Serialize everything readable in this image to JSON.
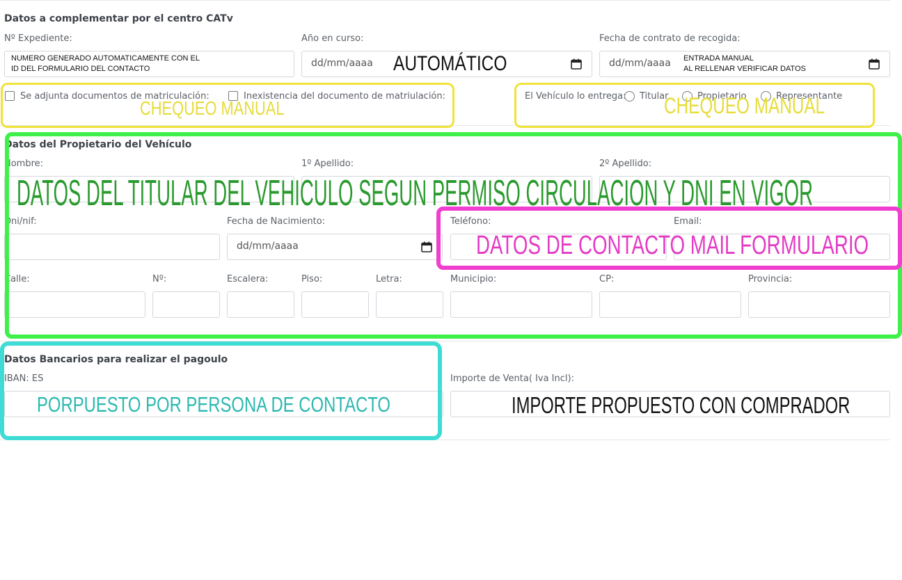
{
  "sections": {
    "centro": "Datos a complementar por el centro CATv",
    "propietario": "Datos del Propietario del Vehículo",
    "bancarios": "Datos Bancarios para realizar el pagoulo"
  },
  "labels": {
    "expediente": "Nº Expediente:",
    "anio": "Año en curso:",
    "fecha_contrato": "Fecha de contrato de recogida:",
    "adjunta": "Se adjunta documentos de matriculación:",
    "inexistencia": "Inexistencia del documento de matriulación:",
    "entrega": "El Vehículo lo entrega:",
    "titular": "Titular",
    "propietario": "Propietario",
    "representante": "Representante",
    "nombre": "Nombre:",
    "apellido1": "1º Apellido:",
    "apellido2": "2º Apellido:",
    "dni": "Dni/nif:",
    "nacimiento": "Fecha de Nacimiento:",
    "telefono": "Teléfono:",
    "email": "Email:",
    "calle": "Calle:",
    "numero": "Nº:",
    "escalera": "Escalera:",
    "piso": "Piso:",
    "letra": "Letra:",
    "municipio": "Municipio:",
    "cp": "CP:",
    "provincia": "Provincia:",
    "iban": "IBAN: ES",
    "importe": "Importe de Venta( Iva Incl):"
  },
  "placeholders": {
    "date": "dd/mm/aaaa"
  },
  "notes": {
    "expediente_1": "NUMERO GENERADO AUTOMATICAMENTE CON EL",
    "expediente_2": "ID DEL FORMULARIO DEL CONTACTO",
    "automatico": "AUTOMÁTICO",
    "entrada_1": "ENTRADA MANUAL",
    "entrada_2": "AL RELLENAR VERIFICAR DATOS",
    "chequeo_1": "CHEQUEO MANUAL",
    "chequeo_2": "CHEQUEO MANUAL",
    "titular": "DATOS DEL TITULAR DEL VEHICULO SEGUN PERMISO CIRCULACION Y DNI EN VIGOR",
    "contacto": "DATOS DE CONTACTO MAIL FORMULARIO",
    "iban": "PORPUESTO POR PERSONA DE CONTACTO",
    "importe": "IMPORTE PROPUESTO CON COMPRADOR"
  },
  "colors": {
    "yellow": "#f0e23a",
    "green": "#3ff04a",
    "magenta": "#f03ed0",
    "cyan": "#3fdcd6",
    "yellow_text": "#e6dc3a",
    "green_text": "#2a9a2e",
    "magenta_text": "#e43ac4",
    "cyan_text": "#2ab8b0"
  }
}
